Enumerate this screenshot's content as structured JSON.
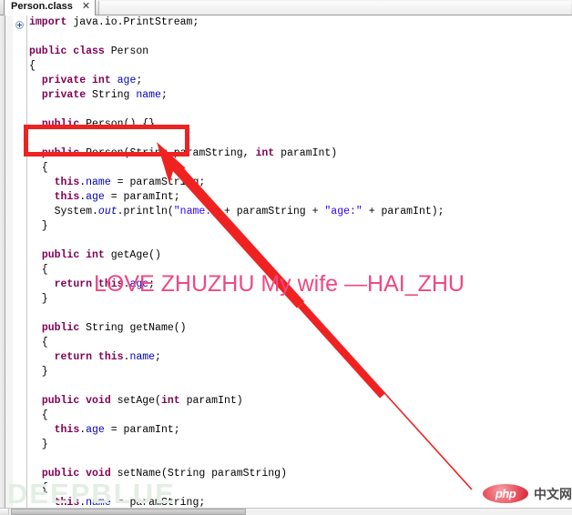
{
  "tab": {
    "label": "Person.class",
    "close_icon": "close-icon",
    "close_glyph": "✕"
  },
  "gutter": {
    "fold_icon": "expand-fold-icon"
  },
  "code": {
    "lines": [
      [
        {
          "t": "import",
          "c": "kw"
        },
        {
          "t": " java.io.PrintStream;",
          "c": ""
        }
      ],
      [],
      [
        {
          "t": "public class",
          "c": "kw"
        },
        {
          "t": " Person",
          "c": ""
        }
      ],
      [
        {
          "t": "{",
          "c": ""
        }
      ],
      [
        {
          "t": "  ",
          "c": ""
        },
        {
          "t": "private int",
          "c": "kw"
        },
        {
          "t": " ",
          "c": ""
        },
        {
          "t": "age",
          "c": "fld"
        },
        {
          "t": ";",
          "c": ""
        }
      ],
      [
        {
          "t": "  ",
          "c": ""
        },
        {
          "t": "private",
          "c": "kw"
        },
        {
          "t": " String ",
          "c": ""
        },
        {
          "t": "name",
          "c": "fld"
        },
        {
          "t": ";",
          "c": ""
        }
      ],
      [],
      [
        {
          "t": "  ",
          "c": ""
        },
        {
          "t": "public",
          "c": "kw"
        },
        {
          "t": " Person() {}",
          "c": ""
        }
      ],
      [],
      [
        {
          "t": "  ",
          "c": ""
        },
        {
          "t": "public",
          "c": "kw"
        },
        {
          "t": " Person(String paramString, ",
          "c": ""
        },
        {
          "t": "int",
          "c": "kw"
        },
        {
          "t": " paramInt)",
          "c": ""
        }
      ],
      [
        {
          "t": "  {",
          "c": ""
        }
      ],
      [
        {
          "t": "    ",
          "c": ""
        },
        {
          "t": "this",
          "c": "kw"
        },
        {
          "t": ".",
          "c": ""
        },
        {
          "t": "name",
          "c": "fld"
        },
        {
          "t": " = paramString;",
          "c": ""
        }
      ],
      [
        {
          "t": "    ",
          "c": ""
        },
        {
          "t": "this",
          "c": "kw"
        },
        {
          "t": ".",
          "c": ""
        },
        {
          "t": "age",
          "c": "fld"
        },
        {
          "t": " = paramInt;",
          "c": ""
        }
      ],
      [
        {
          "t": "    System.",
          "c": ""
        },
        {
          "t": "out",
          "c": "stc"
        },
        {
          "t": ".println(",
          "c": ""
        },
        {
          "t": "\"name:\"",
          "c": "str"
        },
        {
          "t": " + paramString + ",
          "c": ""
        },
        {
          "t": "\"age:\"",
          "c": "str"
        },
        {
          "t": " + paramInt);",
          "c": ""
        }
      ],
      [
        {
          "t": "  }",
          "c": ""
        }
      ],
      [],
      [
        {
          "t": "  ",
          "c": ""
        },
        {
          "t": "public int",
          "c": "kw"
        },
        {
          "t": " getAge()",
          "c": ""
        }
      ],
      [
        {
          "t": "  {",
          "c": ""
        }
      ],
      [
        {
          "t": "    ",
          "c": ""
        },
        {
          "t": "return this",
          "c": "kw"
        },
        {
          "t": ".",
          "c": ""
        },
        {
          "t": "age",
          "c": "fld"
        },
        {
          "t": ";",
          "c": ""
        }
      ],
      [
        {
          "t": "  }",
          "c": ""
        }
      ],
      [],
      [
        {
          "t": "  ",
          "c": ""
        },
        {
          "t": "public",
          "c": "kw"
        },
        {
          "t": " String getName()",
          "c": ""
        }
      ],
      [
        {
          "t": "  {",
          "c": ""
        }
      ],
      [
        {
          "t": "    ",
          "c": ""
        },
        {
          "t": "return this",
          "c": "kw"
        },
        {
          "t": ".",
          "c": ""
        },
        {
          "t": "name",
          "c": "fld"
        },
        {
          "t": ";",
          "c": ""
        }
      ],
      [
        {
          "t": "  }",
          "c": ""
        }
      ],
      [],
      [
        {
          "t": "  ",
          "c": ""
        },
        {
          "t": "public void",
          "c": "kw"
        },
        {
          "t": " setAge(",
          "c": ""
        },
        {
          "t": "int",
          "c": "kw"
        },
        {
          "t": " paramInt)",
          "c": ""
        }
      ],
      [
        {
          "t": "  {",
          "c": ""
        }
      ],
      [
        {
          "t": "    ",
          "c": ""
        },
        {
          "t": "this",
          "c": "kw"
        },
        {
          "t": ".",
          "c": ""
        },
        {
          "t": "age",
          "c": "fld"
        },
        {
          "t": " = paramInt;",
          "c": ""
        }
      ],
      [
        {
          "t": "  }",
          "c": ""
        }
      ],
      [],
      [
        {
          "t": "  ",
          "c": ""
        },
        {
          "t": "public void",
          "c": "kw"
        },
        {
          "t": " setName(String paramString)",
          "c": ""
        }
      ],
      [
        {
          "t": "  {",
          "c": ""
        }
      ],
      [
        {
          "t": "    ",
          "c": ""
        },
        {
          "t": "this",
          "c": "kw"
        },
        {
          "t": ".",
          "c": ""
        },
        {
          "t": "name",
          "c": "fld"
        },
        {
          "t": " = paramString;",
          "c": ""
        }
      ]
    ]
  },
  "annotations": {
    "highlight_box_color": "#ef2222",
    "arrow_color": "#ef2222",
    "overlay_text": "LOVE ZHUZHU My wife —HAI_ZHU",
    "overlay_text_color": "#ee4a82"
  },
  "watermarks": {
    "background_text": "DEEPBLUE",
    "php_word": "php",
    "php_cn": "中文网"
  }
}
